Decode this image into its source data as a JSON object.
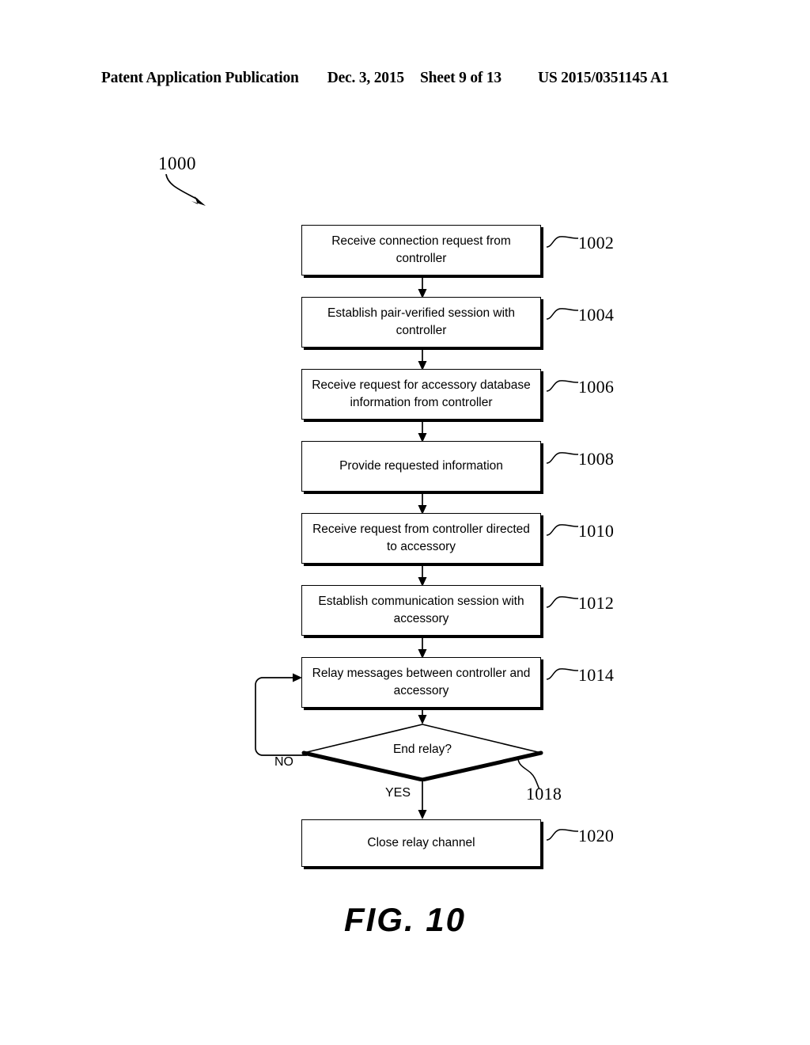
{
  "header": {
    "publication": "Patent Application Publication",
    "date": "Dec. 3, 2015",
    "sheet": "Sheet 9 of 13",
    "document_number": "US 2015/0351145 A1"
  },
  "figure": {
    "caption": "FIG. 10",
    "diagram_reference": "1000"
  },
  "flowchart": {
    "nodes": [
      {
        "id": "1002",
        "type": "process",
        "text": "Receive connection request from controller"
      },
      {
        "id": "1004",
        "type": "process",
        "text": "Establish pair-verified session with controller"
      },
      {
        "id": "1006",
        "type": "process",
        "text": "Receive request for accessory database information from controller"
      },
      {
        "id": "1008",
        "type": "process",
        "text": "Provide requested information"
      },
      {
        "id": "1010",
        "type": "process",
        "text": "Receive request from controller directed to accessory"
      },
      {
        "id": "1012",
        "type": "process",
        "text": "Establish communication session with accessory"
      },
      {
        "id": "1014",
        "type": "process",
        "text": "Relay messages between controller and accessory"
      },
      {
        "id": "1018",
        "type": "decision",
        "text": "End relay?"
      },
      {
        "id": "1020",
        "type": "process",
        "text": "Close relay channel"
      }
    ],
    "branch_labels": {
      "no": "NO",
      "yes": "YES"
    }
  }
}
